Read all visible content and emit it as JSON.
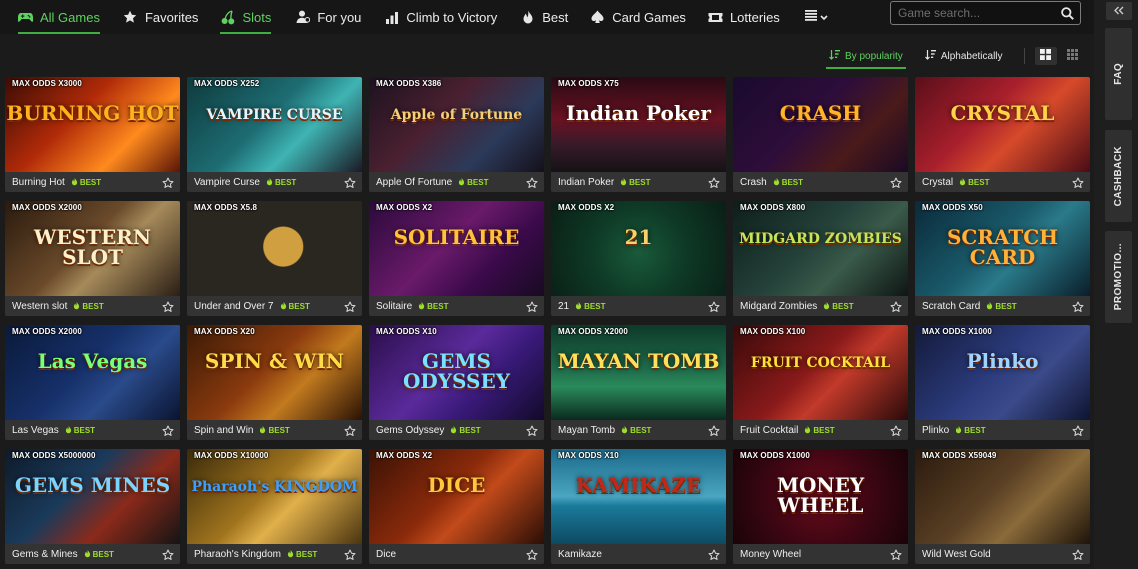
{
  "nav": {
    "items": [
      {
        "label": "All Games",
        "icon": "gamepad-icon",
        "active": true
      },
      {
        "label": "Favorites",
        "icon": "star-icon",
        "active": false
      },
      {
        "label": "Slots",
        "icon": "cherries-icon",
        "active": true
      },
      {
        "label": "For you",
        "icon": "user-icon",
        "active": false
      },
      {
        "label": "Climb to Victory",
        "icon": "bar-chart-icon",
        "active": false
      },
      {
        "label": "Best",
        "icon": "flame-icon",
        "active": false
      },
      {
        "label": "Card Games",
        "icon": "spade-icon",
        "active": false
      },
      {
        "label": "Lotteries",
        "icon": "ticket-icon",
        "active": false
      }
    ],
    "more_icon": "list-chevron-icon"
  },
  "search": {
    "placeholder": "Game search...",
    "icon": "search-icon"
  },
  "sort": {
    "popularity_label": "By popularity",
    "alpha_label": "Alphabetically",
    "active": "popularity",
    "view_active": "large-grid"
  },
  "best_label": "BEST",
  "colors": {
    "accent": "#3fae3f",
    "best": "#9ede2c",
    "bg": "#1b1b1b",
    "card_info": "#333333"
  },
  "games": [
    {
      "name": "Burning Hot",
      "odds": "MAX ODDS X3000",
      "best": true,
      "art": "BURNING HOT",
      "bg": "linear-gradient(135deg,#3b0c05 0%,#b02a08 40%,#ff8a1e 70%,#5a1506 100%)",
      "art_color": "#ffb21e"
    },
    {
      "name": "Vampire Curse",
      "odds": "MAX ODDS X252",
      "best": true,
      "art": "VAMPIRE CURSE",
      "bg": "linear-gradient(135deg,#0e3a3d 0%,#1d6d73 45%,#3fb4b3 65%,#1a1a26 100%)",
      "art_color": "#e7f5ff"
    },
    {
      "name": "Apple Of Fortune",
      "odds": "MAX ODDS X386",
      "best": true,
      "art": "Apple of Fortune",
      "bg": "linear-gradient(135deg,#1c1220 0%,#4a2030 40%,#2c3a5a 70%,#15101a 100%)",
      "art_color": "#f1d07a"
    },
    {
      "name": "Indian Poker",
      "odds": "MAX ODDS X75",
      "best": true,
      "art": "Indian Poker",
      "bg": "linear-gradient(180deg,#2a0a14 0%,#6a1222 45%,#3a1a2a 70%,#141214 100%)",
      "art_color": "#ffffff"
    },
    {
      "name": "Crash",
      "odds": "",
      "best": true,
      "art": "CRASH",
      "bg": "linear-gradient(135deg,#1a0a2e 0%,#2e0d3a 45%,#4a1a1a 70%,#1a0a24 100%)",
      "art_color": "#ffb42a"
    },
    {
      "name": "Crystal",
      "odds": "",
      "best": true,
      "art": "CRYSTAL",
      "bg": "linear-gradient(135deg,#5a0f1a 0%,#a81f2c 40%,#d64a2a 60%,#4a0c16 100%)",
      "art_color": "#ffd347"
    },
    {
      "name": "Western slot",
      "odds": "MAX ODDS X2000",
      "best": true,
      "art": "WESTERN SLOT",
      "bg": "linear-gradient(135deg,#2a1a0e 0%,#6a4a2a 45%,#a68a5a 60%,#2a1e14 100%)",
      "art_color": "#fff0c8"
    },
    {
      "name": "Under and Over 7",
      "odds": "MAX ODDS X5.8",
      "best": true,
      "art": "",
      "bg": "radial-gradient(circle at 55% 48%,#d0a040 0 18%,#2a2620 19% 100%)",
      "art_color": "#ffffff"
    },
    {
      "name": "Solitaire",
      "odds": "MAX ODDS X2",
      "best": true,
      "art": "SOLITAIRE",
      "bg": "linear-gradient(135deg,#2a0a3a 0%,#6a1a6a 45%,#3a0a4a 70%,#180a22 100%)",
      "art_color": "#ffc23a"
    },
    {
      "name": "21",
      "odds": "MAX ODDS X2",
      "best": true,
      "art": "21",
      "bg": "radial-gradient(circle at 50% 55%,#1a5a3a 0%,#0e3a26 45%,#0a1e16 100%)",
      "art_color": "#f5d36a"
    },
    {
      "name": "Midgard Zombies",
      "odds": "MAX ODDS X800",
      "best": true,
      "art": "MIDGARD ZOMBIES",
      "bg": "linear-gradient(135deg,#0e1e1a 0%,#24423a 45%,#3a5a4a 65%,#0e1614 100%)",
      "art_color": "#c2e85a"
    },
    {
      "name": "Scratch Card",
      "odds": "MAX ODDS X50",
      "best": true,
      "art": "SCRATCH CARD",
      "bg": "linear-gradient(135deg,#0a2a3a 0%,#1a5a6a 45%,#2a7a8a 60%,#0a1e2a 100%)",
      "art_color": "#ffb13a"
    },
    {
      "name": "Las Vegas",
      "odds": "MAX ODDS X2000",
      "best": true,
      "art": "Las Vegas",
      "bg": "linear-gradient(135deg,#0a1a3a 0%,#16306a 45%,#2a4a8a 65%,#0a1430 100%)",
      "art_color": "#7aff7a"
    },
    {
      "name": "Spin and Win",
      "odds": "MAX ODDS X20",
      "best": true,
      "art": "SPIN & WIN",
      "bg": "linear-gradient(135deg,#3a1a06 0%,#8a3a0e 45%,#c27a1e 65%,#2a1206 100%)",
      "art_color": "#ffdb4a"
    },
    {
      "name": "Gems Odyssey",
      "odds": "MAX ODDS X10",
      "best": true,
      "art": "GEMS ODYSSEY",
      "bg": "linear-gradient(135deg,#2a0e4a 0%,#5a2a9a 45%,#3a1a7a 65%,#120a2a 100%)",
      "art_color": "#7ae0ff"
    },
    {
      "name": "Mayan Tomb",
      "odds": "MAX ODDS X2000",
      "best": true,
      "art": "MAYAN TOMB",
      "bg": "linear-gradient(180deg,#0e3a2a 0%,#1e6a4a 45%,#2a8a5a 65%,#0a2a1e 100%)",
      "art_color": "#ffe05a"
    },
    {
      "name": "Fruit Cocktail",
      "odds": "MAX ODDS X100",
      "best": true,
      "art": "FRUIT COCKTAIL",
      "bg": "linear-gradient(135deg,#3a0a0a 0%,#8a1a1a 45%,#c23a2a 60%,#2a0a0a 100%)",
      "art_color": "#ffe23a"
    },
    {
      "name": "Plinko",
      "odds": "MAX ODDS X1000",
      "best": true,
      "art": "Plinko",
      "bg": "linear-gradient(135deg,#141a3a 0%,#2a3a7a 45%,#3a4a8a 65%,#0e1430 100%)",
      "art_color": "#9ed4ff"
    },
    {
      "name": "Gems & Mines",
      "odds": "MAX ODDS X5000000",
      "best": true,
      "art": "GEMS MINES",
      "bg": "linear-gradient(135deg,#0e1a2a 0%,#1a3a5a 40%,#8a2a1a 65%,#141414 100%)",
      "art_color": "#7ad4ff"
    },
    {
      "name": "Pharaoh's Kingdom",
      "odds": "MAX ODDS X10000",
      "best": true,
      "art": "Pharaoh's KINGDOM",
      "bg": "linear-gradient(135deg,#3a2a0a 0%,#a0741e 45%,#e0b04a 60%,#4a3410 100%)",
      "art_color": "#3aa0ff"
    },
    {
      "name": "Dice",
      "odds": "MAX ODDS X2",
      "best": false,
      "art": "DICE",
      "bg": "linear-gradient(135deg,#3a1206 0%,#8a2a0a 45%,#c24a1a 60%,#2a0e06 100%)",
      "art_color": "#ffc83a"
    },
    {
      "name": "Kamikaze",
      "odds": "MAX ODDS X10",
      "best": false,
      "art": "KAMIKAZE",
      "bg": "linear-gradient(180deg,#1a6a8a 0%,#4aa6c2 50%,#1a7a9a 60%,#0e4a62 100%)",
      "art_color": "#c2281a"
    },
    {
      "name": "Money Wheel",
      "odds": "MAX ODDS X1000",
      "best": false,
      "art": "MONEY WHEEL",
      "bg": "radial-gradient(circle at 50% 50%,#6a0a1a 0%,#3a0612 55%,#1a0408 100%)",
      "art_color": "#ffffff"
    },
    {
      "name": "Wild West Gold",
      "odds": "MAX ODDS X59049",
      "best": false,
      "art": "",
      "bg": "linear-gradient(135deg,#2a1a0e 0%,#5a4024 45%,#8a6a3a 65%,#1e140a 100%)",
      "art_color": "#ffe08a"
    }
  ],
  "rail": {
    "collapse_icon": "double-chevron-left-icon",
    "tabs": [
      "FAQ",
      "CASHBACK",
      "PROMOTIO..."
    ]
  }
}
